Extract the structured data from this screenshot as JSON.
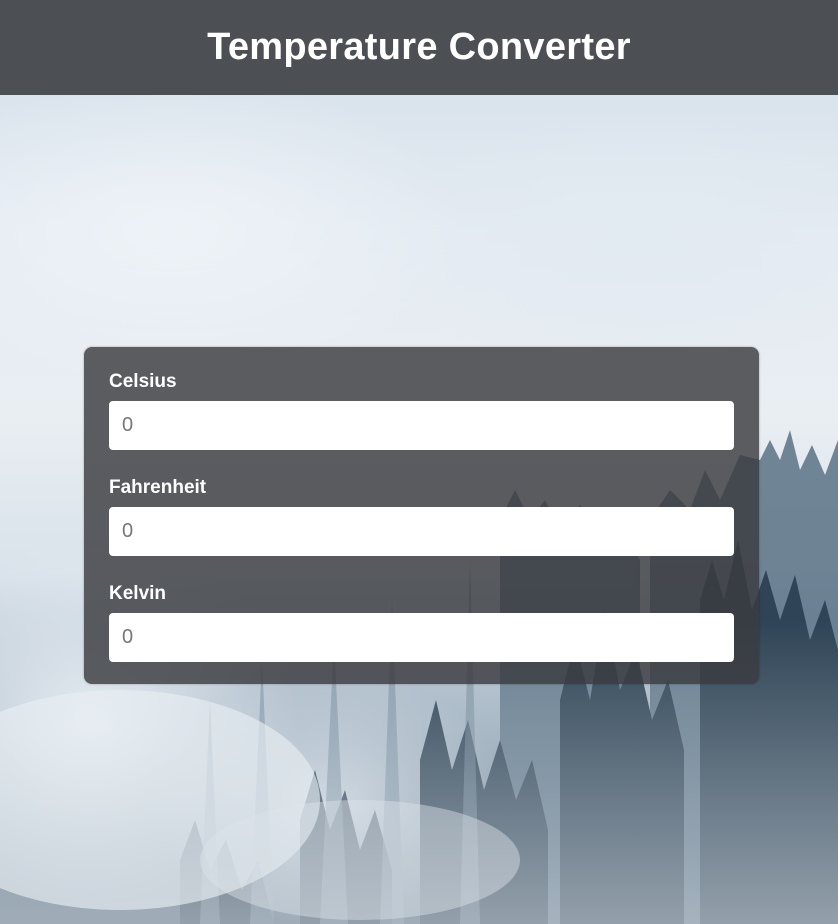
{
  "header": {
    "title": "Temperature Converter"
  },
  "converter": {
    "fields": [
      {
        "label": "Celsius",
        "value": "",
        "placeholder": "0"
      },
      {
        "label": "Fahrenheit",
        "value": "",
        "placeholder": "0"
      },
      {
        "label": "Kelvin",
        "value": "",
        "placeholder": "0"
      }
    ]
  },
  "colors": {
    "header_background": "#404246",
    "card_background": "#3a3c3f",
    "text": "#ffffff",
    "input_background": "#ffffff",
    "placeholder_text": "#777777"
  }
}
